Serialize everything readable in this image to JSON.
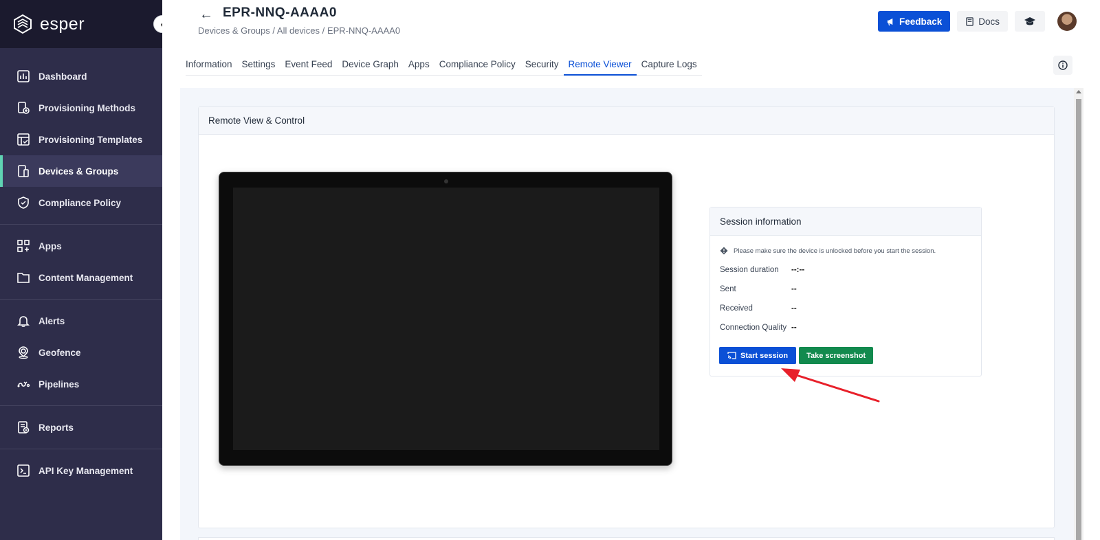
{
  "brand": {
    "name": "esper"
  },
  "sidebar": {
    "items": [
      {
        "label": "Dashboard",
        "icon": "dashboard-icon"
      },
      {
        "label": "Provisioning Methods",
        "icon": "provisioning-methods-icon"
      },
      {
        "label": "Provisioning Templates",
        "icon": "provisioning-templates-icon"
      },
      {
        "label": "Devices & Groups",
        "icon": "devices-icon",
        "active": true
      },
      {
        "label": "Compliance Policy",
        "icon": "shield-icon"
      },
      {
        "label": "Apps",
        "icon": "apps-grid-icon"
      },
      {
        "label": "Content Management",
        "icon": "folder-icon"
      },
      {
        "label": "Alerts",
        "icon": "bell-icon"
      },
      {
        "label": "Geofence",
        "icon": "map-pin-icon"
      },
      {
        "label": "Pipelines",
        "icon": "pipeline-icon"
      },
      {
        "label": "Reports",
        "icon": "report-icon"
      },
      {
        "label": "API Key Management",
        "icon": "terminal-icon"
      }
    ]
  },
  "header": {
    "title": "EPR-NNQ-AAAA0",
    "breadcrumb": [
      "Devices & Groups",
      "/ All devices",
      "/ EPR-NNQ-AAAA0"
    ],
    "feedback_label": "Feedback",
    "docs_label": "Docs"
  },
  "tabs": [
    {
      "label": "Information"
    },
    {
      "label": "Settings"
    },
    {
      "label": "Event Feed"
    },
    {
      "label": "Device Graph"
    },
    {
      "label": "Apps"
    },
    {
      "label": "Compliance Policy"
    },
    {
      "label": "Security"
    },
    {
      "label": "Remote Viewer",
      "active": true
    },
    {
      "label": "Capture Logs"
    }
  ],
  "remote": {
    "card_title": "Remote View & Control",
    "session": {
      "title": "Session information",
      "notice": "Please make sure the device is unlocked before you start the session.",
      "rows": [
        {
          "label": "Session duration",
          "value": "--:--"
        },
        {
          "label": "Sent",
          "value": "--"
        },
        {
          "label": "Received",
          "value": "--"
        },
        {
          "label": "Connection Quality",
          "value": "--"
        }
      ],
      "start_label": "Start session",
      "screenshot_label": "Take screenshot"
    }
  },
  "colors": {
    "sidebar_bg": "#2e2d4a",
    "accent": "#0b50d6",
    "active_indicator": "#5fd3b3",
    "screenshot_button": "#128a4e",
    "annotation_arrow": "#e8202a"
  }
}
